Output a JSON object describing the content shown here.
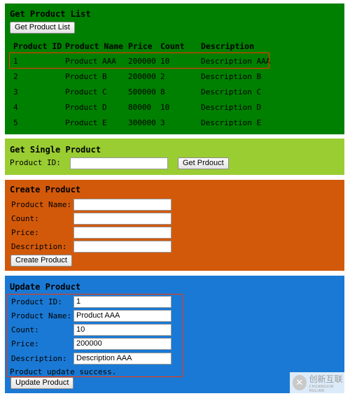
{
  "list_panel": {
    "title": "Get Product List",
    "button": "Get Product List",
    "columns": [
      "Product ID",
      "Product Name",
      "Price",
      "Count",
      "Description"
    ],
    "rows": [
      [
        "1",
        "Product AAA",
        "200000",
        "10",
        "Description AAA"
      ],
      [
        "2",
        "Product B",
        "200000",
        "2",
        "Description B"
      ],
      [
        "3",
        "Product C",
        "500000",
        "8",
        "Description C"
      ],
      [
        "4",
        "Product D",
        "80000",
        "10",
        "Description D"
      ],
      [
        "5",
        "Product E",
        "300000",
        "3",
        "Description E"
      ]
    ]
  },
  "single_panel": {
    "title": "Get Single Product",
    "id_label": "Product ID:",
    "id_value": "",
    "button": "Get Prdouct"
  },
  "create_panel": {
    "title": "Create Product",
    "name_label": "Product Name:",
    "count_label": "Count:",
    "price_label": "Price:",
    "desc_label": "Description:",
    "name_value": "",
    "count_value": "",
    "price_value": "",
    "desc_value": "",
    "button": "Create Product"
  },
  "update_panel": {
    "title": "Update Product",
    "id_label": "Product ID:",
    "name_label": "Product Name:",
    "count_label": "Count:",
    "price_label": "Price:",
    "desc_label": "Description:",
    "id_value": "1",
    "name_value": "Product AAA",
    "count_value": "10",
    "price_value": "200000",
    "desc_value": "Description AAA",
    "status": "Product update success.",
    "button": "Update Product"
  },
  "watermark": {
    "text": "创新互联",
    "sub": "CHUANGXIN HULIAN",
    "icon": "watermark-logo-icon"
  },
  "colors": {
    "list_bg": "#008000",
    "single_bg": "#9acd32",
    "create_bg": "#d2590a",
    "update_bg": "#1a79d4",
    "highlight": "#ff3300"
  }
}
